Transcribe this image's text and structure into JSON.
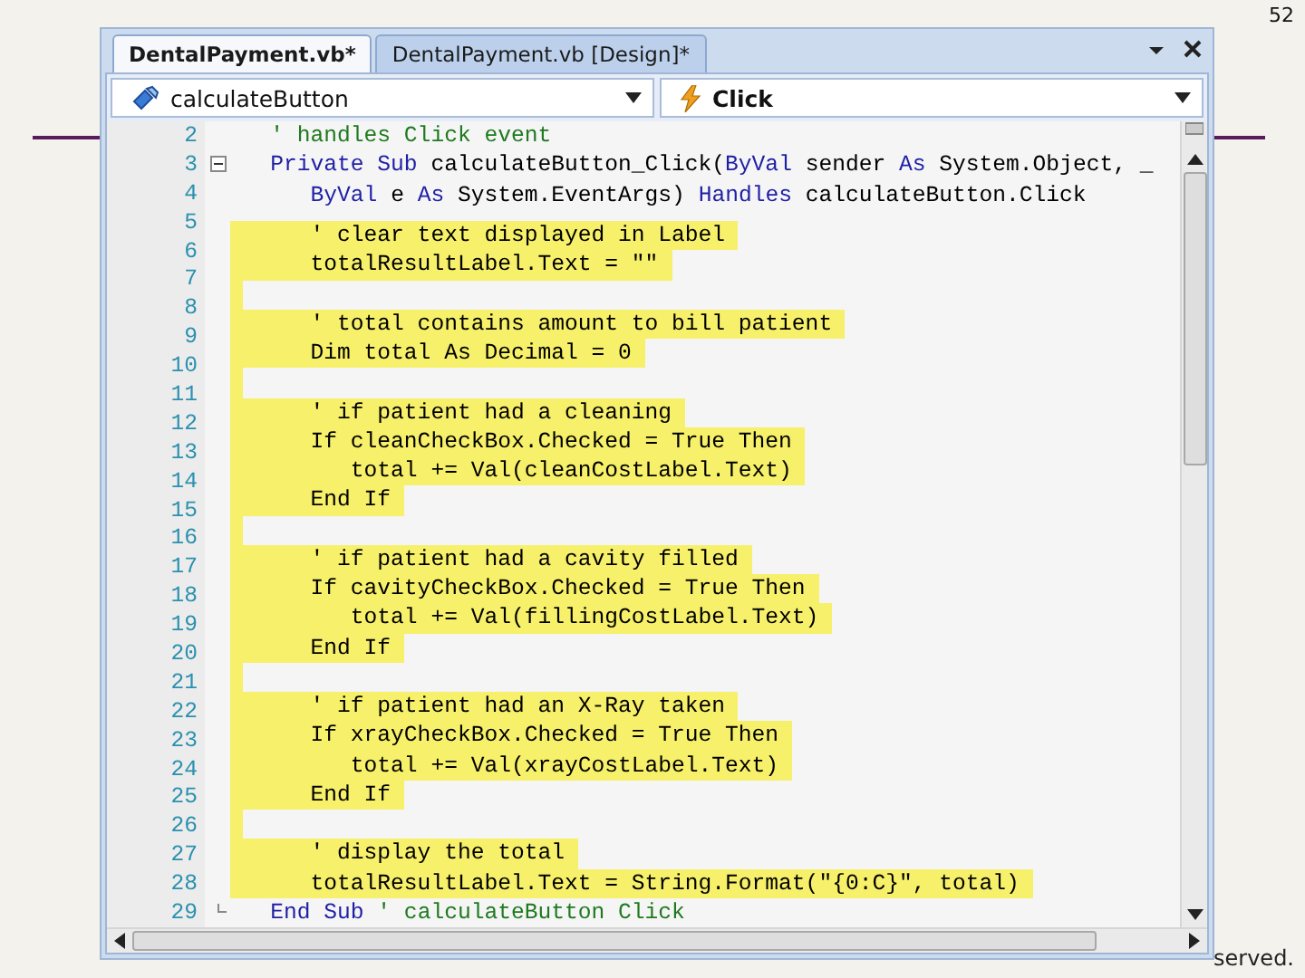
{
  "slide": {
    "page_number": "52",
    "footer_fragment": "served."
  },
  "editor": {
    "tabs": [
      {
        "label": "DentalPayment.vb*",
        "selected": true
      },
      {
        "label": "DentalPayment.vb [Design]*",
        "selected": false
      }
    ],
    "object_dropdown": {
      "value": "calculateButton"
    },
    "event_dropdown": {
      "value": "Click"
    },
    "lines": [
      {
        "number": "2",
        "highlighted": false,
        "segments": [
          {
            "kind": "comment",
            "text": "   ' handles Click event"
          }
        ]
      },
      {
        "number": "3",
        "highlighted": false,
        "kind": "block_start",
        "segments": [
          {
            "kind": "keyword",
            "text": "   Private Sub"
          },
          {
            "kind": "plain",
            "text": " calculateButton_Click("
          },
          {
            "kind": "keyword",
            "text": "ByVal"
          },
          {
            "kind": "plain",
            "text": " sender "
          },
          {
            "kind": "keyword",
            "text": "As"
          },
          {
            "kind": "plain",
            "text": " System.Object, _"
          }
        ]
      },
      {
        "number": "4",
        "highlighted": false,
        "segments": [
          {
            "kind": "keyword",
            "text": "      ByVal"
          },
          {
            "kind": "plain",
            "text": " e "
          },
          {
            "kind": "keyword",
            "text": "As"
          },
          {
            "kind": "plain",
            "text": " System.EventArgs) "
          },
          {
            "kind": "keyword",
            "text": "Handles"
          },
          {
            "kind": "plain",
            "text": " calculateButton.Click"
          }
        ]
      },
      {
        "number": "5",
        "highlighted": false
      },
      {
        "number": "6",
        "highlighted": true,
        "segments": [
          {
            "kind": "plain",
            "text": "      ' clear text displayed in Label"
          }
        ]
      },
      {
        "number": "7",
        "highlighted": true,
        "segments": [
          {
            "kind": "plain",
            "text": "      totalResultLabel.Text = \"\""
          }
        ]
      },
      {
        "number": "8",
        "highlighted": true
      },
      {
        "number": "9",
        "highlighted": true,
        "segments": [
          {
            "kind": "plain",
            "text": "      ' total contains amount to bill patient"
          }
        ]
      },
      {
        "number": "10",
        "highlighted": true,
        "segments": [
          {
            "kind": "plain",
            "text": "      Dim total As Decimal = 0"
          }
        ]
      },
      {
        "number": "11",
        "highlighted": true
      },
      {
        "number": "12",
        "highlighted": true,
        "segments": [
          {
            "kind": "plain",
            "text": "      ' if patient had a cleaning"
          }
        ]
      },
      {
        "number": "13",
        "highlighted": true,
        "segments": [
          {
            "kind": "plain",
            "text": "      If cleanCheckBox.Checked = True Then"
          }
        ]
      },
      {
        "number": "14",
        "highlighted": true,
        "segments": [
          {
            "kind": "plain",
            "text": "         total += Val(cleanCostLabel.Text)"
          }
        ]
      },
      {
        "number": "15",
        "highlighted": true,
        "segments": [
          {
            "kind": "plain",
            "text": "      End If"
          }
        ]
      },
      {
        "number": "16",
        "highlighted": true
      },
      {
        "number": "17",
        "highlighted": true,
        "segments": [
          {
            "kind": "plain",
            "text": "      ' if patient had a cavity filled"
          }
        ]
      },
      {
        "number": "18",
        "highlighted": true,
        "segments": [
          {
            "kind": "plain",
            "text": "      If cavityCheckBox.Checked = True Then"
          }
        ]
      },
      {
        "number": "19",
        "highlighted": true,
        "segments": [
          {
            "kind": "plain",
            "text": "         total += Val(fillingCostLabel.Text)"
          }
        ]
      },
      {
        "number": "20",
        "highlighted": true,
        "segments": [
          {
            "kind": "plain",
            "text": "      End If"
          }
        ]
      },
      {
        "number": "21",
        "highlighted": true
      },
      {
        "number": "22",
        "highlighted": true,
        "segments": [
          {
            "kind": "plain",
            "text": "      ' if patient had an X-Ray taken"
          }
        ]
      },
      {
        "number": "23",
        "highlighted": true,
        "segments": [
          {
            "kind": "plain",
            "text": "      If xrayCheckBox.Checked = True Then"
          }
        ]
      },
      {
        "number": "24",
        "highlighted": true,
        "segments": [
          {
            "kind": "plain",
            "text": "         total += Val(xrayCostLabel.Text)"
          }
        ]
      },
      {
        "number": "25",
        "highlighted": true,
        "segments": [
          {
            "kind": "plain",
            "text": "      End If"
          }
        ]
      },
      {
        "number": "26",
        "highlighted": true
      },
      {
        "number": "27",
        "highlighted": true,
        "segments": [
          {
            "kind": "plain",
            "text": "      ' display the total"
          }
        ]
      },
      {
        "number": "28",
        "highlighted": true,
        "segments": [
          {
            "kind": "plain",
            "text": "      totalResultLabel.Text = String.Format(\"{0:C}\", total)"
          }
        ]
      },
      {
        "number": "29",
        "highlighted": false,
        "kind": "block_end",
        "segments": [
          {
            "kind": "keyword",
            "text": "   End Sub"
          },
          {
            "kind": "comment",
            "text": " ' calculateButton Click"
          }
        ]
      }
    ]
  }
}
